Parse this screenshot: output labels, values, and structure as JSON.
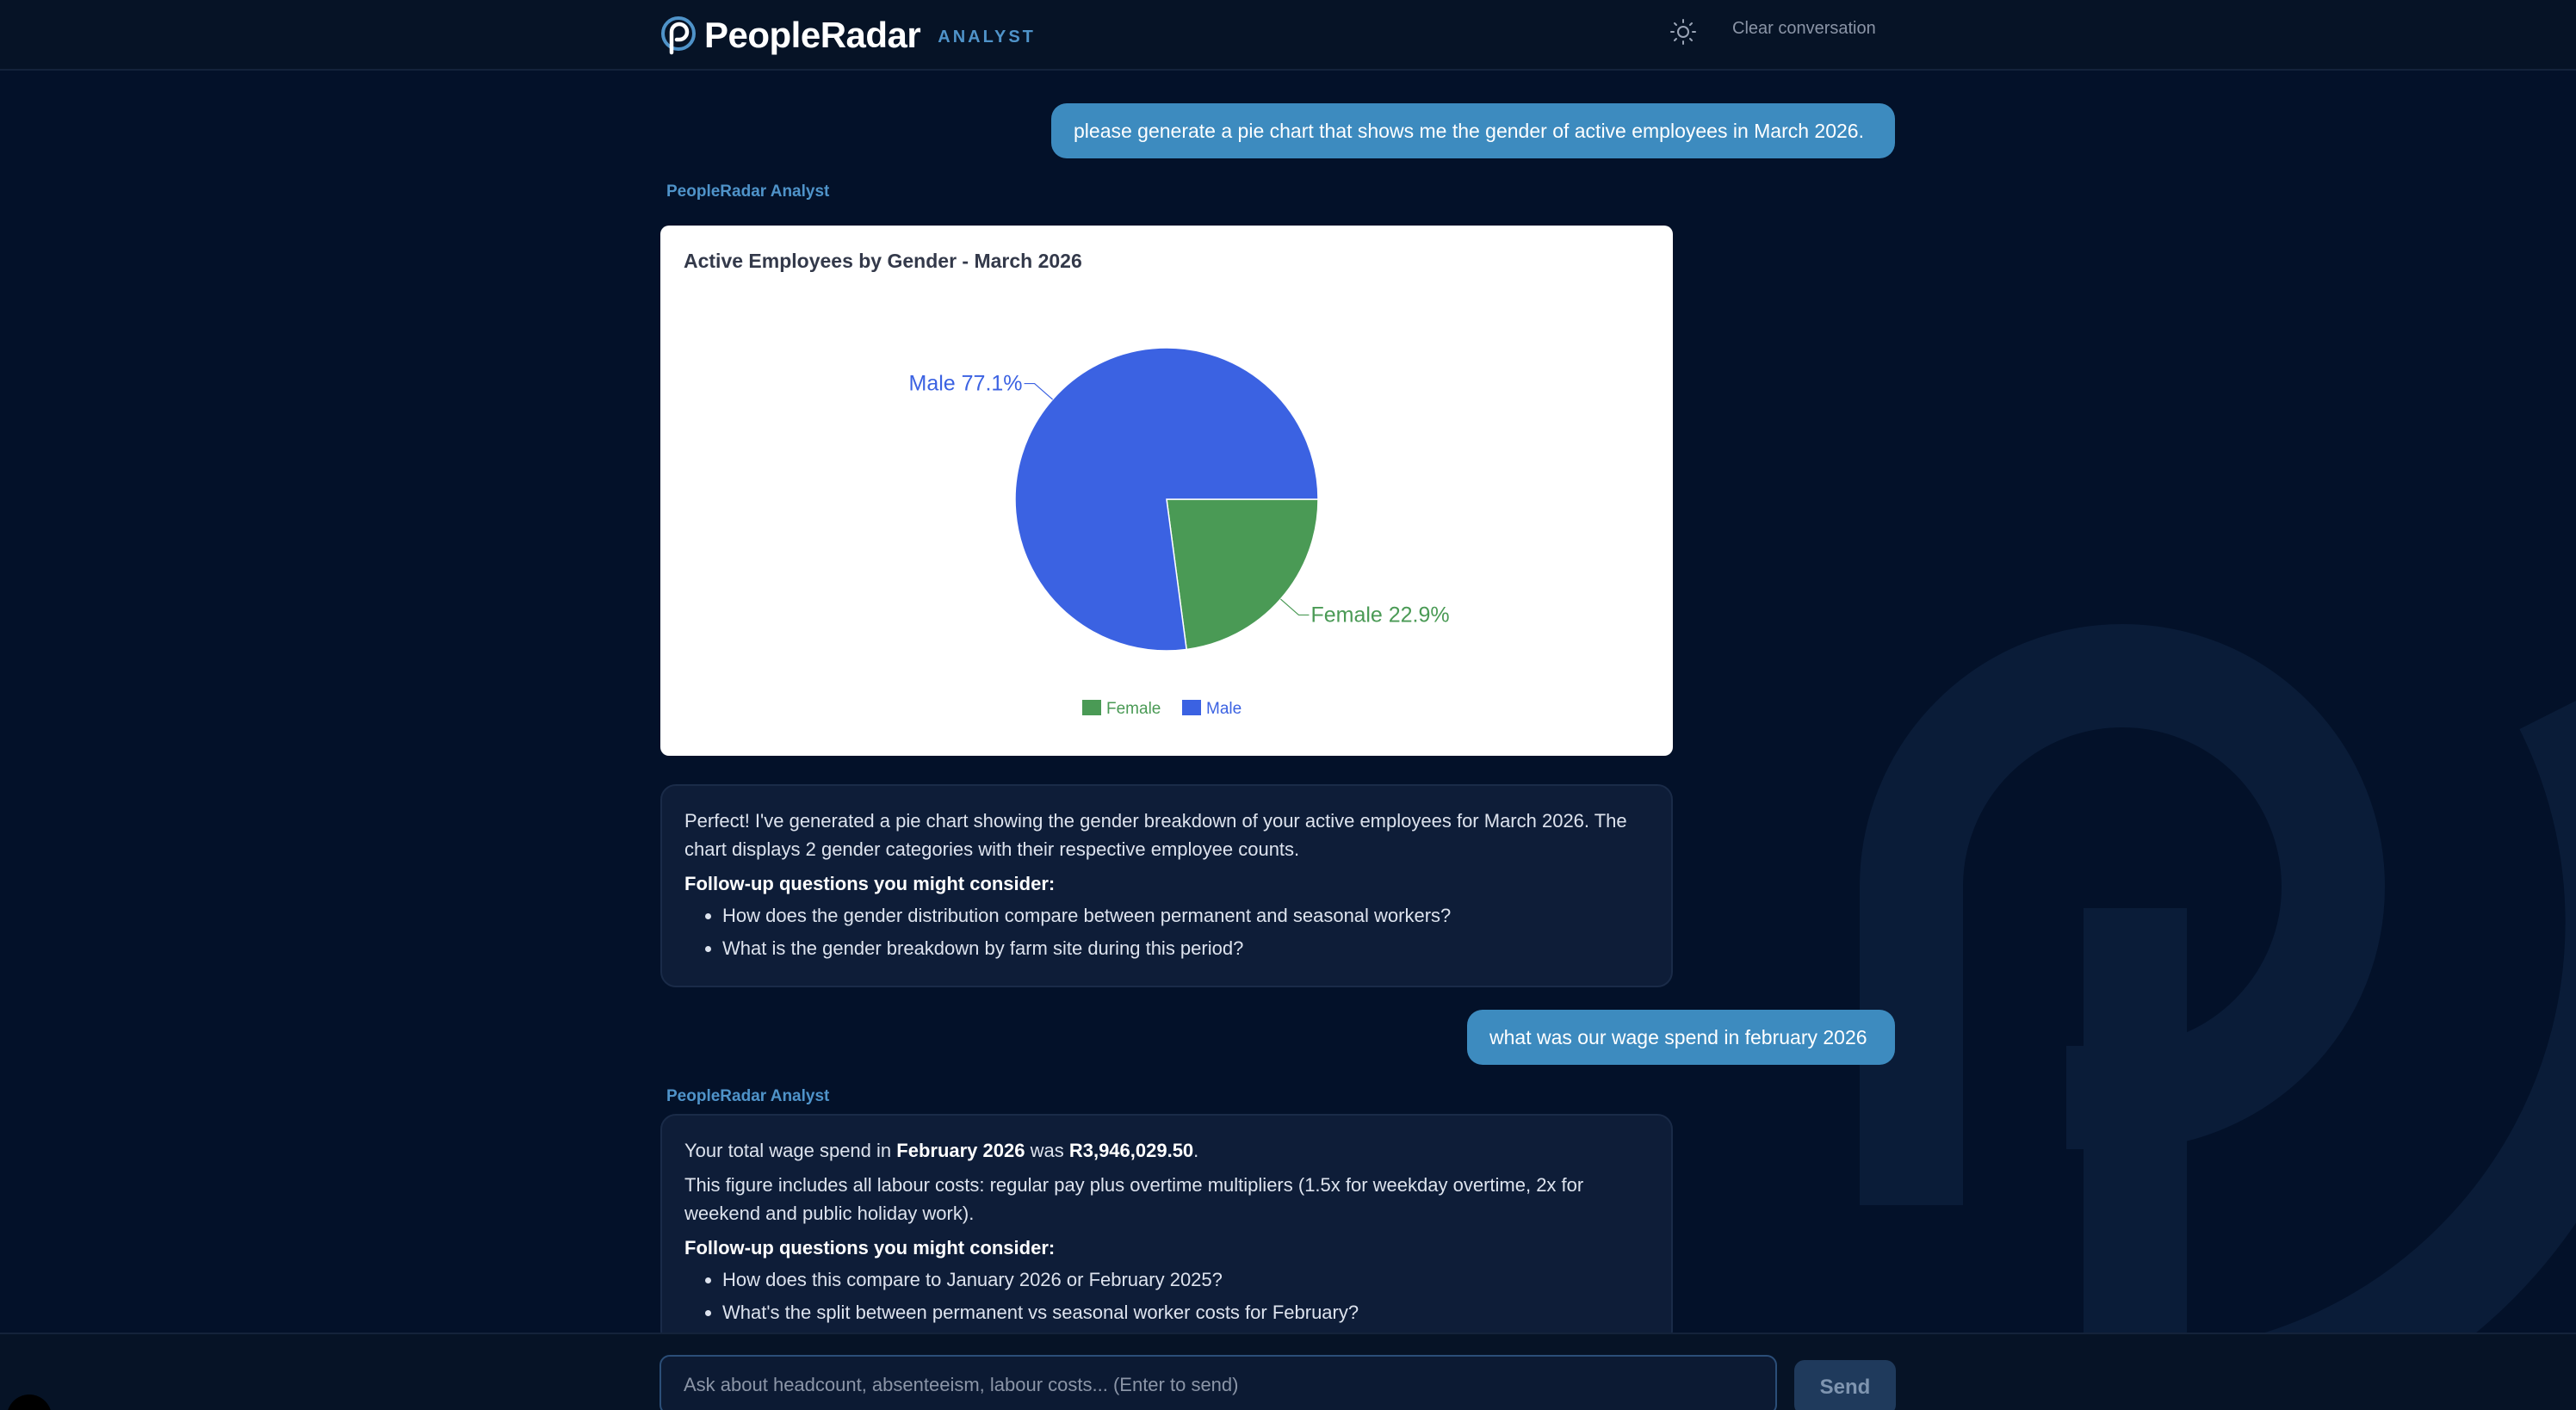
{
  "header": {
    "brand_name": "PeopleRadar",
    "brand_tag": "ANALYST",
    "theme_icon": "sun-icon",
    "clear_label": "Clear conversation"
  },
  "conversation": {
    "user_message_1": "please generate a pie chart that shows me the gender of active employees in March 2026.",
    "assistant_label_1": "PeopleRadar Analyst",
    "reply_1": {
      "text_1": "Perfect! I've generated a pie chart showing the gender breakdown of your active employees for March 2026. The chart displays 2 gender categories with their respective employee counts.",
      "follow_title": "Follow-up questions you might consider:",
      "followups": [
        "How does the gender distribution compare between permanent and seasonal workers?",
        "What is the gender breakdown by farm site during this period?"
      ]
    },
    "user_message_2": "what was our wage spend in february 2026",
    "assistant_label_2": "PeopleRadar Analyst",
    "reply_2": {
      "lead": "Your total wage spend in ",
      "period": "February 2026",
      "mid": " was ",
      "amount": "R3,946,029.50",
      "tail": ".",
      "text_2": "This figure includes all labour costs: regular pay plus overtime multipliers (1.5x for weekday overtime, 2x for weekend and public holiday work).",
      "follow_title": "Follow-up questions you might consider:",
      "followups": [
        "How does this compare to January 2026 or February 2025?",
        "What's the split between permanent vs seasonal worker costs for February?"
      ]
    }
  },
  "chart_data": {
    "type": "pie",
    "title": "Active Employees by Gender - March 2026",
    "categories": [
      "Female",
      "Male"
    ],
    "values": [
      22.9,
      77.1
    ],
    "labels": [
      "Female 22.9%",
      "Male 77.1%"
    ],
    "colors": [
      "#4a9a55",
      "#3b62e2"
    ],
    "legend_position": "bottom",
    "legend": [
      "Female",
      "Male"
    ]
  },
  "input": {
    "placeholder": "Ask about headcount, absenteeism, labour costs... (Enter to send)",
    "send_label": "Send"
  }
}
